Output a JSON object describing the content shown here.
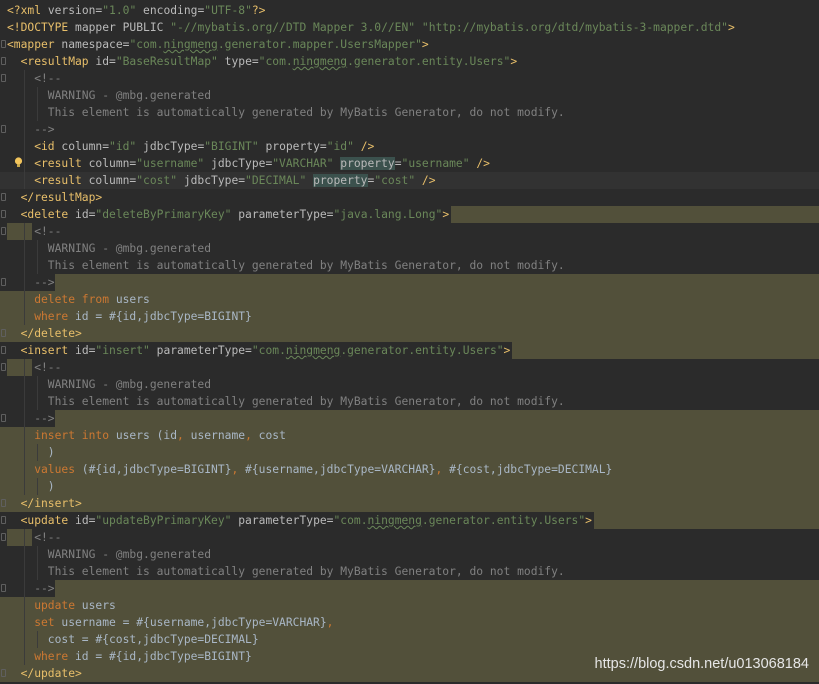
{
  "editor": {
    "language": "XML",
    "lines": [
      {
        "segs": [
          [
            "t",
            "<?xml "
          ],
          [
            "a",
            "version="
          ],
          [
            "s",
            "\"1.0\""
          ],
          [
            "a",
            " encoding="
          ],
          [
            "s",
            "\"UTF-8\""
          ],
          [
            "t",
            "?>"
          ]
        ]
      },
      {
        "segs": [
          [
            "t",
            "<!DOCTYPE "
          ],
          [
            "a",
            "mapper PUBLIC "
          ],
          [
            "s",
            "\"-//mybatis.org//DTD Mapper 3.0//EN\""
          ],
          [
            "a",
            " "
          ],
          [
            "s",
            "\"http://mybatis.org/dtd/mybatis-3-mapper.dtd\""
          ],
          [
            "t",
            ">"
          ]
        ]
      },
      {
        "segs": [
          [
            "t",
            "<mapper "
          ],
          [
            "a",
            "namespace="
          ],
          [
            "s",
            "\"com.ningmeng.generator.mapper.UsersMapper\""
          ],
          [
            "t",
            ">"
          ]
        ],
        "fold": true
      },
      {
        "indent": 1,
        "segs": [
          [
            "t",
            "<resultMap "
          ],
          [
            "a",
            "id="
          ],
          [
            "s",
            "\"BaseResultMap\""
          ],
          [
            "a",
            " type="
          ],
          [
            "s",
            "\"com.ningmeng.generator.entity.Users\""
          ],
          [
            "t",
            ">"
          ]
        ],
        "fold": true
      },
      {
        "indent": 2,
        "segs": [
          [
            "c",
            "<!--"
          ]
        ],
        "fold": true
      },
      {
        "indent": 3,
        "segs": [
          [
            "c",
            "WARNING - @mbg.generated"
          ]
        ]
      },
      {
        "indent": 3,
        "segs": [
          [
            "c",
            "This element is automatically generated by MyBatis Generator, do not modify."
          ]
        ]
      },
      {
        "indent": 2,
        "segs": [
          [
            "c",
            "-->"
          ]
        ],
        "fold": true
      },
      {
        "indent": 2,
        "segs": [
          [
            "t",
            "<id "
          ],
          [
            "a",
            "column="
          ],
          [
            "s",
            "\"id\""
          ],
          [
            "a",
            " jdbcType="
          ],
          [
            "s",
            "\"BIGINT\""
          ],
          [
            "a",
            " property="
          ],
          [
            "s",
            "\"id\""
          ],
          [
            "t",
            " />"
          ]
        ]
      },
      {
        "indent": 2,
        "segs": [
          [
            "t",
            "<result "
          ],
          [
            "a",
            "column="
          ],
          [
            "s",
            "\"username\""
          ],
          [
            "a",
            " jdbcType="
          ],
          [
            "s",
            "\"VARCHAR\""
          ],
          [
            "a",
            " "
          ],
          [
            "m",
            "property"
          ],
          [
            "a",
            "="
          ],
          [
            "s",
            "\"username\""
          ],
          [
            "t",
            " />"
          ]
        ],
        "bulb": true
      },
      {
        "indent": 2,
        "segs": [
          [
            "t",
            "<result "
          ],
          [
            "a",
            "column="
          ],
          [
            "s",
            "\"cost\""
          ],
          [
            "a",
            " jdbcType="
          ],
          [
            "s",
            "\"DECIMAL\""
          ],
          [
            "a",
            " "
          ],
          [
            "m",
            "property"
          ],
          [
            "a",
            "="
          ],
          [
            "s",
            "\"cost\""
          ],
          [
            "t",
            " />"
          ]
        ],
        "current": true
      },
      {
        "indent": 1,
        "segs": [
          [
            "t",
            "</resultMap>"
          ]
        ],
        "fold": true
      },
      {
        "indent": 1,
        "segs": [
          [
            "t",
            "<delete "
          ],
          [
            "a",
            "id="
          ],
          [
            "s",
            "\"deleteByPrimaryKey\""
          ],
          [
            "a",
            " parameterType="
          ],
          [
            "s",
            "\"java.lang.Long\""
          ],
          [
            "t",
            ">"
          ]
        ],
        "fold": true,
        "hl": "tail"
      },
      {
        "indent": 2,
        "segs": [
          [
            "c",
            "<!--"
          ]
        ],
        "fold": true,
        "hl": "head"
      },
      {
        "indent": 3,
        "segs": [
          [
            "c",
            "WARNING - @mbg.generated"
          ]
        ]
      },
      {
        "indent": 3,
        "segs": [
          [
            "c",
            "This element is automatically generated by MyBatis Generator, do not modify."
          ]
        ]
      },
      {
        "indent": 2,
        "segs": [
          [
            "c",
            "-->"
          ]
        ],
        "fold": true,
        "hl": "tail"
      },
      {
        "indent": 2,
        "segs": [
          [
            "k",
            "delete from "
          ],
          [
            "p",
            "users"
          ]
        ],
        "hl": "full"
      },
      {
        "indent": 2,
        "segs": [
          [
            "k",
            "where "
          ],
          [
            "p",
            "id = "
          ],
          [
            "p",
            "#{id,jdbcType=BIGINT}"
          ]
        ],
        "hl": "full"
      },
      {
        "indent": 1,
        "segs": [
          [
            "t",
            "</delete>"
          ]
        ],
        "fold": true,
        "hl": "full"
      },
      {
        "indent": 1,
        "segs": [
          [
            "t",
            "<insert "
          ],
          [
            "a",
            "id="
          ],
          [
            "s",
            "\"insert\""
          ],
          [
            "a",
            " parameterType="
          ],
          [
            "s",
            "\"com.ningmeng.generator.entity.Users\""
          ],
          [
            "t",
            ">"
          ]
        ],
        "fold": true,
        "hl": "tail"
      },
      {
        "indent": 2,
        "segs": [
          [
            "c",
            "<!--"
          ]
        ],
        "fold": true,
        "hl": "head"
      },
      {
        "indent": 3,
        "segs": [
          [
            "c",
            "WARNING - @mbg.generated"
          ]
        ]
      },
      {
        "indent": 3,
        "segs": [
          [
            "c",
            "This element is automatically generated by MyBatis Generator, do not modify."
          ]
        ]
      },
      {
        "indent": 2,
        "segs": [
          [
            "c",
            "-->"
          ]
        ],
        "fold": true,
        "hl": "tail"
      },
      {
        "indent": 2,
        "segs": [
          [
            "k",
            "insert into "
          ],
          [
            "p",
            "users (id"
          ],
          [
            "k",
            ", "
          ],
          [
            "p",
            "username"
          ],
          [
            "k",
            ", "
          ],
          [
            "p",
            "cost"
          ]
        ],
        "hl": "full"
      },
      {
        "indent": 3,
        "segs": [
          [
            "p",
            ")"
          ]
        ],
        "hl": "full"
      },
      {
        "indent": 2,
        "segs": [
          [
            "k",
            "values "
          ],
          [
            "p",
            "(#{id,jdbcType=BIGINT}"
          ],
          [
            "k",
            ", "
          ],
          [
            "p",
            "#{username,jdbcType=VARCHAR}"
          ],
          [
            "k",
            ", "
          ],
          [
            "p",
            "#{cost,jdbcType=DECIMAL}"
          ]
        ],
        "hl": "full"
      },
      {
        "indent": 3,
        "segs": [
          [
            "p",
            ")"
          ]
        ],
        "hl": "full"
      },
      {
        "indent": 1,
        "segs": [
          [
            "t",
            "</insert>"
          ]
        ],
        "fold": true,
        "hl": "full"
      },
      {
        "indent": 1,
        "segs": [
          [
            "t",
            "<update "
          ],
          [
            "a",
            "id="
          ],
          [
            "s",
            "\"updateByPrimaryKey\""
          ],
          [
            "a",
            " parameterType="
          ],
          [
            "s",
            "\"com.ningmeng.generator.entity.Users\""
          ],
          [
            "t",
            ">"
          ]
        ],
        "fold": true,
        "hl": "tail"
      },
      {
        "indent": 2,
        "segs": [
          [
            "c",
            "<!--"
          ]
        ],
        "fold": true,
        "hl": "head"
      },
      {
        "indent": 3,
        "segs": [
          [
            "c",
            "WARNING - @mbg.generated"
          ]
        ]
      },
      {
        "indent": 3,
        "segs": [
          [
            "c",
            "This element is automatically generated by MyBatis Generator, do not modify."
          ]
        ]
      },
      {
        "indent": 2,
        "segs": [
          [
            "c",
            "-->"
          ]
        ],
        "fold": true,
        "hl": "tail"
      },
      {
        "indent": 2,
        "segs": [
          [
            "k",
            "update "
          ],
          [
            "p",
            "users"
          ]
        ],
        "hl": "full"
      },
      {
        "indent": 2,
        "segs": [
          [
            "k",
            "set "
          ],
          [
            "p",
            "username = #{username,jdbcType=VARCHAR}"
          ],
          [
            "k",
            ","
          ]
        ],
        "hl": "full"
      },
      {
        "indent": 3,
        "segs": [
          [
            "p",
            "cost = #{cost,jdbcType=DECIMAL}"
          ]
        ],
        "hl": "full"
      },
      {
        "indent": 2,
        "segs": [
          [
            "k",
            "where "
          ],
          [
            "p",
            "id = #{id,jdbcType=BIGINT}"
          ]
        ],
        "hl": "full"
      },
      {
        "indent": 1,
        "segs": [
          [
            "t",
            "</update>"
          ]
        ],
        "fold": true,
        "hl": "full"
      }
    ]
  },
  "watermark": "https://blog.csdn.net/u013068184",
  "colors": {
    "background": "#2b2b2b",
    "tag": "#e8bf6a",
    "attribute": "#bababa",
    "string": "#6a8759",
    "comment": "#808080",
    "keyword": "#cc7832",
    "sql_highlight": "#52503a"
  }
}
